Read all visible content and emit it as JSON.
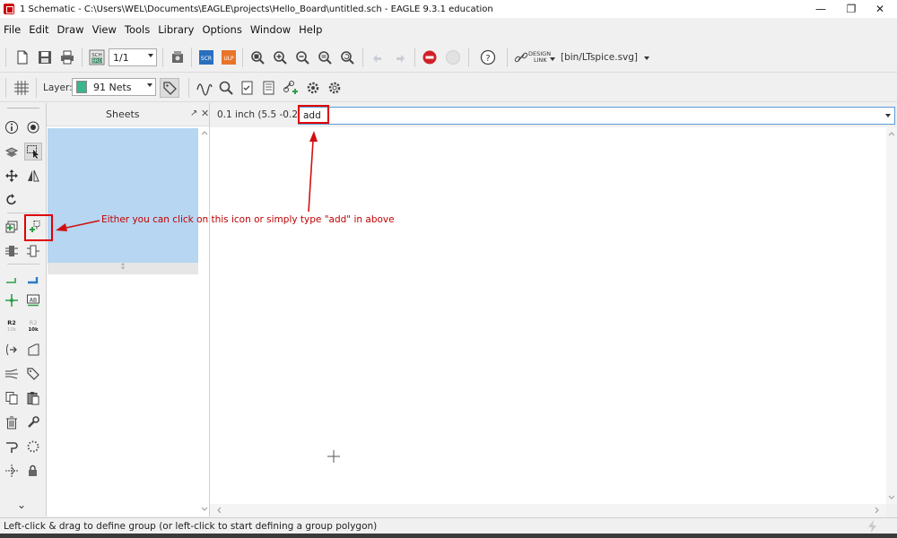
{
  "window": {
    "title": "1 Schematic - C:\\Users\\WEL\\Documents\\EAGLE\\projects\\Hello_Board\\untitled.sch - EAGLE 9.3.1 education",
    "minimize_glyph": "—",
    "restore_glyph": "❐",
    "close_glyph": "✕"
  },
  "menu": [
    "File",
    "Edit",
    "Draw",
    "View",
    "Tools",
    "Library",
    "Options",
    "Window",
    "Help"
  ],
  "toolbar": {
    "sheet_select_value": "1/1",
    "scr_label": "SCR",
    "ulp_label": "ULP",
    "sch_brd_top": "SCH",
    "sch_brd_bottom": "BRD",
    "help_glyph": "?",
    "design_link_top": "DESIGN",
    "design_link_bottom": "LINK",
    "script_menu": "[bin/LTspice.svg]",
    "layer_label": "Layer:",
    "layer_value": "91 Nets",
    "layer_color": "#3cb48c"
  },
  "sheets_panel": {
    "title": "Sheets",
    "pin_glyph": "↗",
    "close_glyph": "✕",
    "grip_glyph": "↕",
    "thumb_color": "#b6d6f2"
  },
  "command_bar": {
    "coordinates": "0.1 inch (5.5 -0.2)",
    "command_value": "add"
  },
  "side_tools": {
    "netlabel_text": "AB",
    "name_top": "R2",
    "name_bottom": "10k",
    "value_top": "R2",
    "value_bottom": "10k",
    "expand_glyph": "⌄"
  },
  "annotation": {
    "text": "Either you can click on this icon or simply type \"add\" in above",
    "color": "#c00000"
  },
  "status": {
    "message": "Left-click & drag to define group (or left-click to start defining a group polygon)"
  },
  "colors": {
    "accent_blue": "#5b9bd5",
    "highlight_red": "#e00000",
    "stop_red": "#d0202a",
    "net_green": "#2e9e4a",
    "bus_blue": "#2a7ac8"
  }
}
